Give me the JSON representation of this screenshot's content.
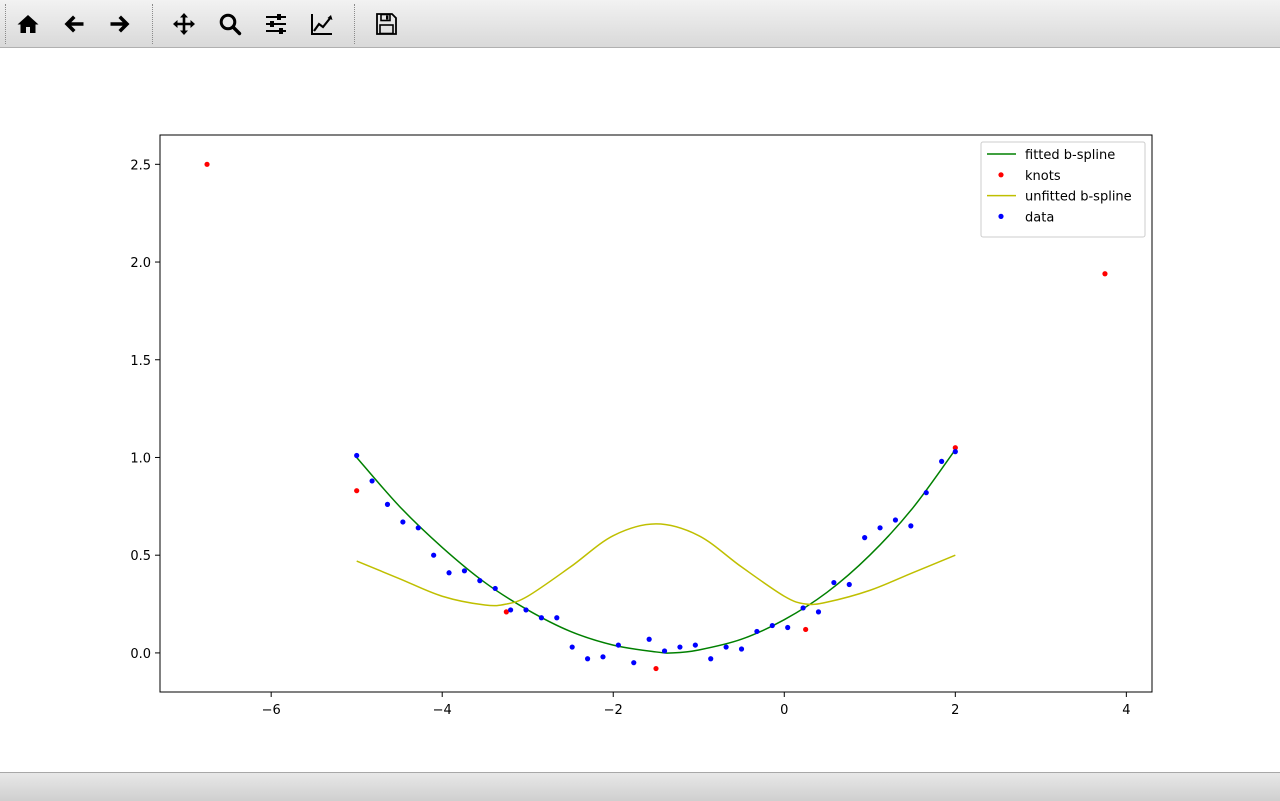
{
  "toolbar": {
    "buttons": [
      {
        "name": "home-icon"
      },
      {
        "name": "back-arrow-icon"
      },
      {
        "name": "forward-arrow-icon"
      },
      {
        "name": "pan-move-icon"
      },
      {
        "name": "zoom-magnifier-icon"
      },
      {
        "name": "configure-subplots-icon"
      },
      {
        "name": "edit-axis-curve-icon"
      },
      {
        "name": "save-floppy-icon"
      }
    ]
  },
  "status": {
    "message": ""
  },
  "chart_data": {
    "type": "line",
    "title": "",
    "xlabel": "",
    "ylabel": "",
    "xlim": [
      -7.3,
      4.3
    ],
    "ylim": [
      -0.2,
      2.65
    ],
    "xticks": [
      -6,
      -4,
      -2,
      0,
      2,
      4
    ],
    "yticks": [
      0.0,
      0.5,
      1.0,
      1.5,
      2.0,
      2.5
    ],
    "xtick_labels": [
      "−6",
      "−4",
      "−2",
      "0",
      "2",
      "4"
    ],
    "ytick_labels": [
      "0.0",
      "0.5",
      "1.0",
      "1.5",
      "2.0",
      "2.5"
    ],
    "grid": false,
    "legend_location": "upper right",
    "colors": {
      "fitted": "#008000",
      "knots": "#ff0000",
      "unfitted": "#bfbf00",
      "data": "#0000ff"
    },
    "series": [
      {
        "name": "fitted b-spline",
        "kind": "line",
        "color": "#008000",
        "x": [
          -5.0,
          -4.5,
          -4.0,
          -3.5,
          -3.0,
          -2.5,
          -2.0,
          -1.5,
          -1.3,
          -1.0,
          -0.5,
          0.0,
          0.5,
          1.0,
          1.5,
          2.0
        ],
        "y": [
          1.0,
          0.75,
          0.54,
          0.36,
          0.22,
          0.11,
          0.04,
          0.005,
          0.0,
          0.015,
          0.07,
          0.17,
          0.31,
          0.5,
          0.74,
          1.04
        ]
      },
      {
        "name": "knots",
        "kind": "scatter",
        "color": "#ff0000",
        "x": [
          -6.75,
          -5.0,
          -3.25,
          -1.5,
          0.25,
          2.0,
          3.75
        ],
        "y": [
          2.5,
          0.83,
          0.21,
          -0.08,
          0.12,
          1.05,
          1.94
        ]
      },
      {
        "name": "unfitted b-spline",
        "kind": "line",
        "color": "#bfbf00",
        "x": [
          -5.0,
          -4.5,
          -4.0,
          -3.5,
          -3.25,
          -3.0,
          -2.5,
          -2.0,
          -1.5,
          -1.0,
          -0.5,
          0.0,
          0.25,
          0.5,
          1.0,
          1.5,
          2.0
        ],
        "y": [
          0.47,
          0.38,
          0.29,
          0.245,
          0.25,
          0.29,
          0.44,
          0.6,
          0.66,
          0.6,
          0.44,
          0.29,
          0.25,
          0.26,
          0.32,
          0.41,
          0.5
        ]
      },
      {
        "name": "data",
        "kind": "scatter",
        "color": "#0000ff",
        "x": [
          -5.0,
          -4.82,
          -4.64,
          -4.46,
          -4.28,
          -4.1,
          -3.92,
          -3.74,
          -3.56,
          -3.38,
          -3.2,
          -3.02,
          -2.84,
          -2.66,
          -2.48,
          -2.3,
          -2.12,
          -1.94,
          -1.76,
          -1.58,
          -1.4,
          -1.22,
          -1.04,
          -0.86,
          -0.68,
          -0.5,
          -0.32,
          -0.14,
          0.04,
          0.22,
          0.4,
          0.58,
          0.76,
          0.94,
          1.12,
          1.3,
          1.48,
          1.66,
          1.84,
          2.0
        ],
        "y": [
          1.01,
          0.88,
          0.76,
          0.67,
          0.64,
          0.5,
          0.41,
          0.42,
          0.37,
          0.33,
          0.22,
          0.22,
          0.18,
          0.18,
          0.03,
          -0.03,
          -0.02,
          0.04,
          -0.05,
          0.07,
          0.01,
          0.03,
          0.04,
          -0.03,
          0.03,
          0.02,
          0.11,
          0.14,
          0.13,
          0.23,
          0.21,
          0.36,
          0.35,
          0.59,
          0.64,
          0.68,
          0.65,
          0.82,
          0.98,
          1.03
        ]
      }
    ]
  }
}
